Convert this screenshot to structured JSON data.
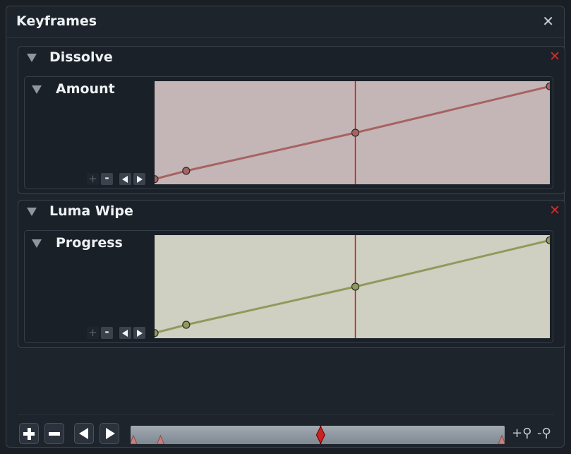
{
  "window": {
    "title": "Keyframes",
    "close_glyph": "✕"
  },
  "colors": {
    "accent_red": "#d42a2a",
    "dissolve_graph_bg": "#c4b6b6",
    "dissolve_line": "#a86262",
    "luma_graph_bg": "#cfcfc2",
    "luma_line": "#8f9a5c",
    "playhead": "#cc2222"
  },
  "groups": [
    {
      "name": "Dissolve",
      "remove_glyph": "✕",
      "params": [
        {
          "name": "Amount",
          "buttons": {
            "add": "+",
            "remove": "-"
          },
          "keyframes": [
            {
              "t": 0.0,
              "v": 0.05
            },
            {
              "t": 0.08,
              "v": 0.13
            },
            {
              "t": 0.508,
              "v": 0.5
            },
            {
              "t": 1.0,
              "v": 0.95
            }
          ],
          "playhead": 0.508
        }
      ]
    },
    {
      "name": "Luma Wipe",
      "remove_glyph": "✕",
      "params": [
        {
          "name": "Progress",
          "buttons": {
            "add": "+",
            "remove": "-"
          },
          "keyframes": [
            {
              "t": 0.0,
              "v": 0.05
            },
            {
              "t": 0.08,
              "v": 0.13
            },
            {
              "t": 0.508,
              "v": 0.5
            },
            {
              "t": 1.0,
              "v": 0.95
            }
          ],
          "playhead": 0.508
        }
      ]
    }
  ],
  "toolbar": {
    "add_keyframe": "+",
    "remove_keyframe": "−",
    "zoom_in": "+⚲",
    "zoom_out": "-⚲"
  },
  "timeline": {
    "playhead": 0.508,
    "keyframe_markers": [
      0.0,
      0.08,
      1.0
    ]
  }
}
